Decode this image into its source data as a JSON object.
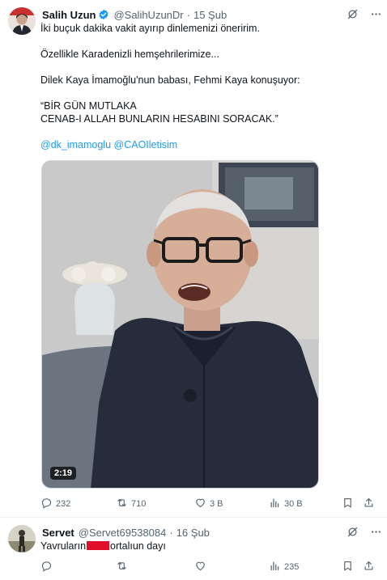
{
  "tweet1": {
    "name": "Salih Uzun",
    "handle": "@SalihUzunDr",
    "separator": "·",
    "date": "15 Şub",
    "lines": [
      "İki buçuk dakika vakit ayırıp dinlemenizi öneririm.",
      "Özellikle Karadenizli hemşehrilerimize...",
      "Dilek Kaya İmamoğlu'nun babası, Fehmi Kaya konuşuyor:",
      "“BİR GÜN MUTLAKA",
      "CENAB-I ALLAH BUNLARIN HESABINI SORACAK.”"
    ],
    "mentions": [
      "@dk_imamoglu",
      "@CAOIletisim"
    ],
    "video_duration": "2:19",
    "actions": {
      "replies": "232",
      "reposts": "710",
      "likes": "3 B",
      "views": "30 B"
    }
  },
  "tweet2": {
    "name": "Servet",
    "handle": "@Servet69538084",
    "separator": "·",
    "date": "16 Şub",
    "text_before": "Yavruların",
    "text_after": "ortalıun dayı",
    "actions": {
      "replies": "",
      "reposts": "",
      "likes": "",
      "views": "235"
    }
  },
  "icons": {
    "verified": "verified-badge-icon",
    "grok": "grok-icon",
    "more": "more-icon",
    "reply": "reply-icon",
    "repost": "repost-icon",
    "like": "like-icon",
    "views": "views-icon",
    "bookmark": "bookmark-icon",
    "share": "share-icon"
  },
  "colors": {
    "accent": "#1d9bf0",
    "secondary_text": "#536471",
    "censor": "#e0102a"
  }
}
